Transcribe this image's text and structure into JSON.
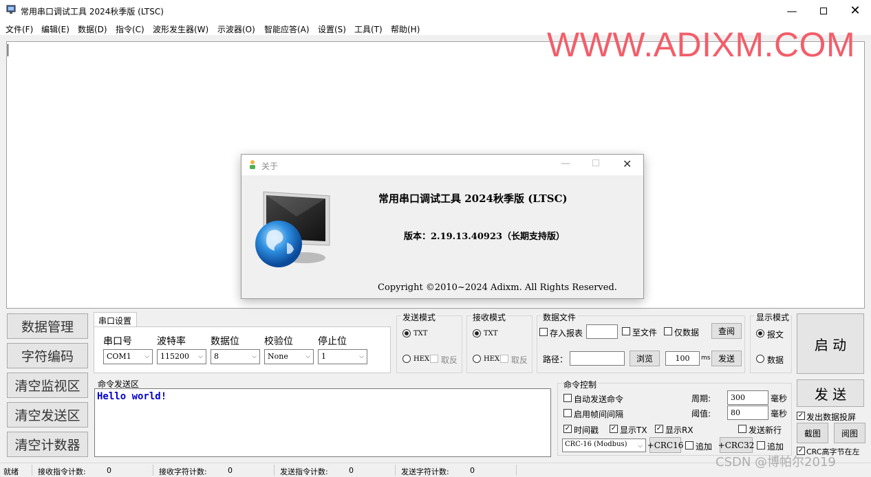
{
  "window": {
    "title": "常用串口调试工具 2024秋季版 (LTSC)"
  },
  "menu": [
    "文件(F)",
    "编辑(E)",
    "数据(D)",
    "指令(C)",
    "波形发生器(W)",
    "示波器(O)",
    "智能应答(A)",
    "设置(S)",
    "工具(T)",
    "帮助(H)"
  ],
  "watermark": "WWW.ADIXM.COM",
  "about": {
    "title": "关于",
    "app_name": "常用串口调试工具 2024秋季版 (LTSC)",
    "version": "版本：2.19.13.40923（长期支持版）",
    "copyright": "Copyright ©2010~2024 Adixm. All Rights Reserved."
  },
  "left_buttons": [
    "数据管理",
    "字符编码",
    "清空监视区",
    "清空发送区",
    "清空计数器"
  ],
  "serial": {
    "tab": "串口设置",
    "port_label": "串口号",
    "port": "COM1",
    "baud_label": "波特率",
    "baud": "115200",
    "databits_label": "数据位",
    "databits": "8",
    "parity_label": "校验位",
    "parity": "None",
    "stopbits_label": "停止位",
    "stopbits": "1"
  },
  "send_mode": {
    "title": "发送模式",
    "txt": "TXT",
    "hex": "HEX",
    "invert": "取反",
    "selected": "TXT"
  },
  "recv_mode": {
    "title": "接收模式",
    "txt": "TXT",
    "hex": "HEX",
    "invert": "取反",
    "selected": "TXT"
  },
  "data_file": {
    "title": "数据文件",
    "save_report": "存入报表",
    "to_file": "至文件",
    "data_only": "仅数据",
    "view": "查阅",
    "path_label": "路径：",
    "browse": "浏览",
    "interval": "100",
    "unit": "ms",
    "send": "发送"
  },
  "display_mode": {
    "title": "显示模式",
    "message": "报文",
    "data": "数据",
    "selected": "报文"
  },
  "start_button": "启 动",
  "send_button": "发 送",
  "cmd_area": {
    "title": "命令发送区",
    "text": "Hello world!"
  },
  "cmd_control": {
    "title": "命令控制",
    "auto_send": "自动发送命令",
    "frame_gap": "启用帧间间隔",
    "period_label": "周期:",
    "period": "300",
    "period_unit": "毫秒",
    "threshold_label": "阈值:",
    "threshold": "80",
    "threshold_unit": "毫秒",
    "timestamp": "时间戳",
    "show_tx": "显示TX",
    "show_rx": "显示RX",
    "send_newline": "发送新行",
    "crc_type": "CRC-16 (Modbus)",
    "crc16": "+CRC16",
    "append1": "追加",
    "crc32": "+CRC32",
    "append2": "追加"
  },
  "right_side": {
    "screen_projection": "发出数据投屏",
    "capture": "截图",
    "view": "阅图",
    "crc_high": "CRC高字节在左"
  },
  "status": {
    "ready": "就绪",
    "recv_cmd_label": "接收指令计数:",
    "recv_cmd": "0",
    "recv_char_label": "接收字符计数:",
    "recv_char": "0",
    "send_cmd_label": "发送指令计数:",
    "send_cmd": "0",
    "send_char_label": "发送字符计数:",
    "send_char": "0"
  },
  "csdn_watermark": "CSDN @博帕尔2019",
  "colors": {
    "watermark": "#f25e6a",
    "cmd_text": "#0000cc"
  }
}
